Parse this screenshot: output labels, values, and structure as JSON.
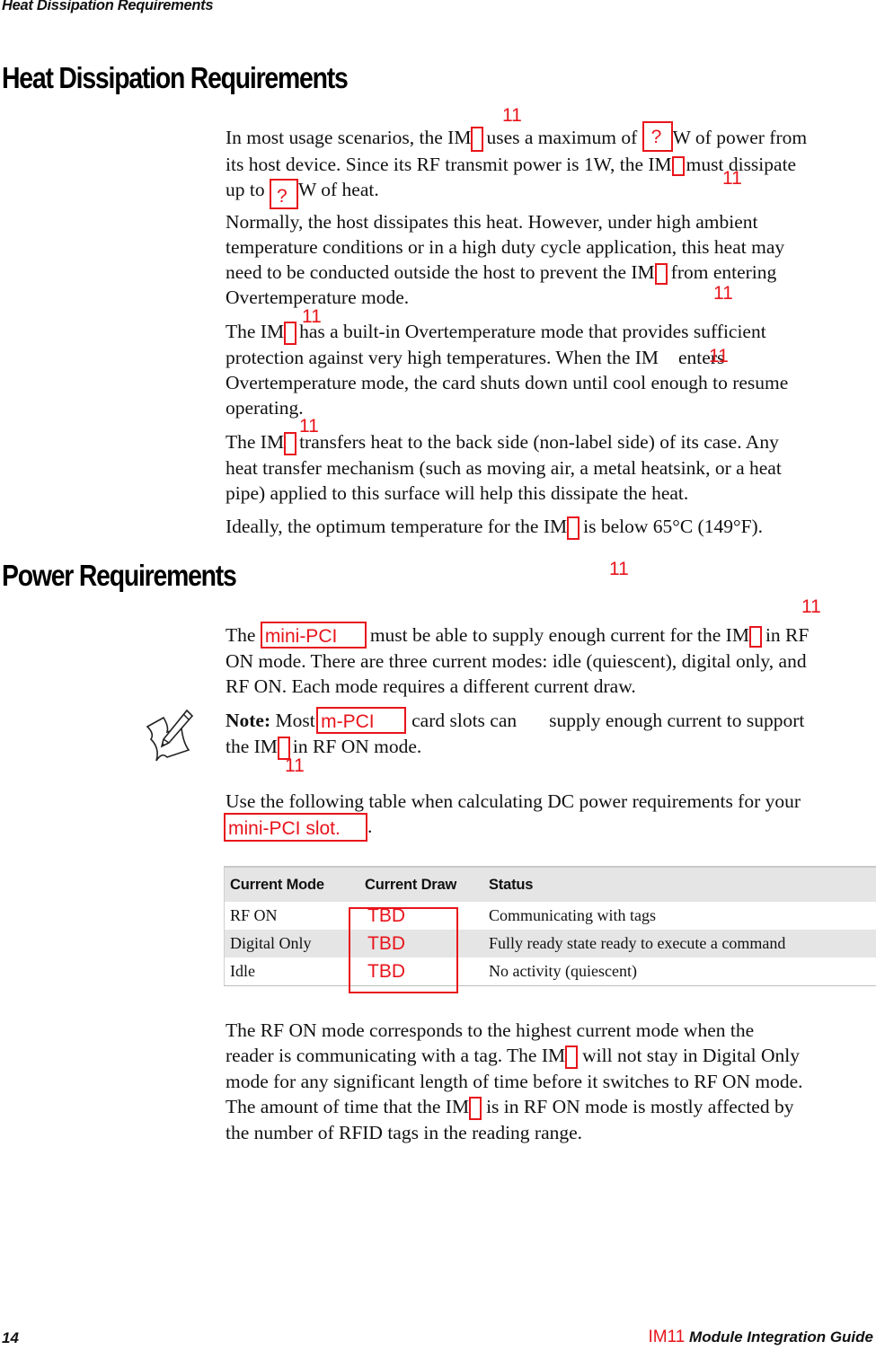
{
  "running_header": "Heat Dissipation Requirements",
  "sections": {
    "heat": {
      "title": "Heat Dissipation Requirements",
      "p1": {
        "l1a": "In most usage scenarios, the IM",
        "l1b": "uses a maximum of",
        "l1c": "W of power from",
        "l2a": "its host device. Since its RF transmit power is 1W, the IM",
        "l2b": "must dissipate",
        "l3a": "up to",
        "l3b": "W of heat."
      },
      "p2": {
        "l1": "Normally, the host dissipates this heat. However, under high ambient",
        "l2": "temperature conditions or in a high duty cycle application, this heat may",
        "l3a": "need to be conducted outside the host to prevent the IM",
        "l3b": "from entering",
        "l4": "Overtemperature mode."
      },
      "p3": {
        "l1a": "The IM",
        "l1b": "has a built-in Overtemperature mode that provides sufficient",
        "l2a": "protection against very high temperatures. When the IM",
        "l2b": "enters",
        "l3": "Overtemperature mode, the card shuts down until cool enough to resume",
        "l4": "operating."
      },
      "p4": {
        "l1a": "The IM",
        "l1b": "transfers heat to the back side (non-label side) of its case. Any",
        "l2": "heat transfer mechanism (such as moving air, a metal heatsink, or a heat",
        "l3": "pipe) applied to this surface will help this dissipate the heat."
      },
      "p5": {
        "l1a": "Ideally, the optimum temperature for the IM",
        "l1b": "is below 65°C (149°F)."
      }
    },
    "power": {
      "title": "Power Requirements",
      "p1": {
        "l1a": "The",
        "l1b": "must be able to supply enough current for the IM",
        "l1c": "in RF",
        "l2": "ON mode. There are three current modes: idle (quiescent), digital only, and",
        "l3": "RF ON. Each mode requires a different current draw."
      },
      "note": {
        "label": "Note:",
        "l1a": "Most",
        "l1b": "card slots can",
        "l1c": "supply enough current to support",
        "l2a": "the IM",
        "l2b": "in RF ON mode."
      },
      "p2": {
        "l1": "Use the following table when calculating DC power requirements for your",
        "l2b": "."
      },
      "table": {
        "headers": [
          "Current Mode",
          "Current Draw",
          "Status"
        ],
        "rows": [
          {
            "mode": "RF ON",
            "draw": "TBD",
            "status": "Communicating with tags"
          },
          {
            "mode": "Digital Only",
            "draw": "TBD",
            "status": "Fully ready state ready to execute a command"
          },
          {
            "mode": "Idle",
            "draw": "TBD",
            "status": "No activity (quiescent)"
          }
        ]
      },
      "p3": {
        "l1": "The RF ON mode corresponds to the highest current mode when the",
        "l2a": "reader is communicating with a tag. The IM",
        "l2b": "will not stay in Digital Only",
        "l3": "mode for any significant length of time before it switches to RF ON mode.",
        "l4a": "The amount of time that the IM",
        "l4b": "is in RF ON mode is mostly affected by",
        "l5": "the number of RFID tags in the reading range."
      }
    }
  },
  "markups": {
    "model_number": "11",
    "unknown": "?",
    "mini_pci": "mini-PCI",
    "m_pci": "m-PCI",
    "mini_pci_slot": "mini-PCI slot."
  },
  "footer": {
    "page_number": "14",
    "model": "IM11",
    "guide_title": " Module Integration Guide"
  },
  "colors": {
    "markup_red": "#e8141b",
    "table_shade": "#e5e5e5"
  }
}
